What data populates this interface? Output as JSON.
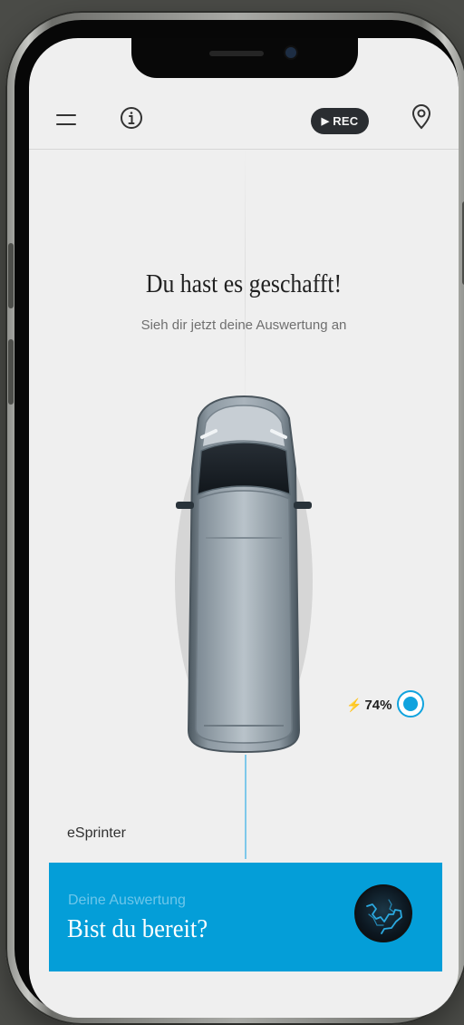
{
  "header": {
    "rec_label": "REC",
    "icons": {
      "menu": "menu-icon",
      "info": "info-icon",
      "play": "play-icon",
      "location": "location-pin-icon"
    }
  },
  "content": {
    "title": "Du hast es geschafft!",
    "subtitle": "Sieh dir jetzt deine Auswertung an",
    "vehicle_name": "eSprinter",
    "battery": {
      "value": "74%",
      "level": 0.74
    }
  },
  "cta": {
    "kicker": "Deine Auswertung",
    "title": "Bist du bereit?",
    "badge_icon": "route-map-icon"
  },
  "colors": {
    "accent": "#049ED8",
    "screen_bg": "#EFEFEF",
    "text_dark": "#202020"
  }
}
